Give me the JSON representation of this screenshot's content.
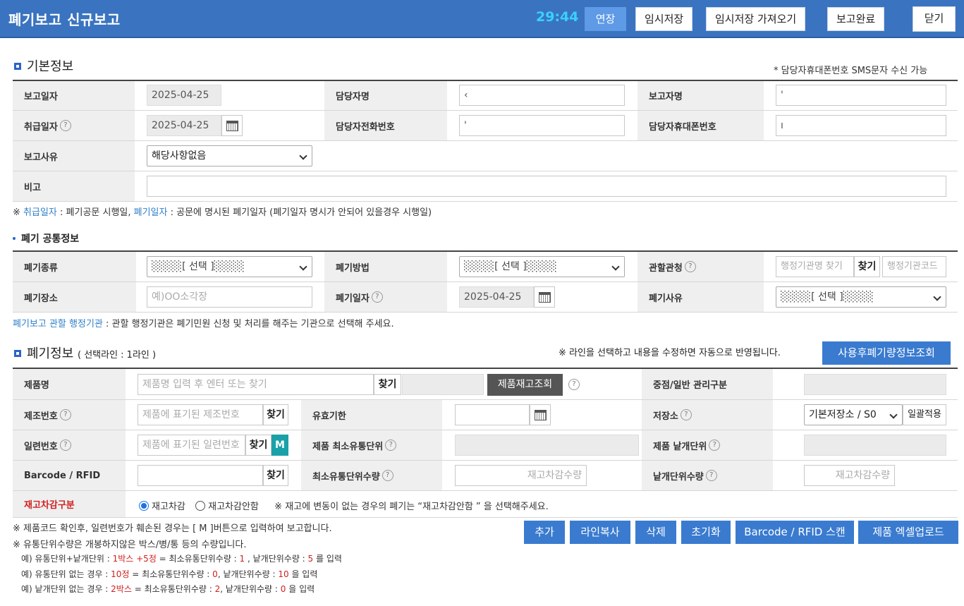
{
  "header": {
    "title": "폐기보고 신규보고",
    "timer": "29:44",
    "extend": "연장",
    "temp_save": "임시저장",
    "temp_load": "임시저장 가져오기",
    "complete": "보고완료",
    "close": "닫기"
  },
  "basic": {
    "title": "기본정보",
    "sms_note": "* 담당자휴대폰번호 SMS문자 수신 가능",
    "report_date_label": "보고일자",
    "report_date": "2025-04-25",
    "manager_label": "담당자명",
    "manager_value": "‹",
    "reporter_label": "보고자명",
    "reporter_value": "'",
    "handle_date_label": "취급일자",
    "handle_date": "2025-04-25",
    "manager_phone_label": "담당자전화번호",
    "manager_phone_value": "'",
    "manager_mobile_label": "담당자휴대폰번호",
    "manager_mobile_value": "ı",
    "reason_label": "보고사유",
    "reason_value": "해당사항없음",
    "memo_label": "비고",
    "help": "?"
  },
  "note1": {
    "mark": "※ ",
    "link1": "취급일자",
    "text1": " : 폐기공문 시행일, ",
    "link2": "폐기일자",
    "text2": " : 공문에 명시된 폐기일자 (폐기일자 명시가 안되어 있을경우 시행일)"
  },
  "common": {
    "title": "폐기 공통정보",
    "type_label": "폐기종류",
    "type_value": "░░░░[ 선택 ]░░░░",
    "method_label": "폐기방법",
    "method_value": "░░░░[ 선택 ]░░░░",
    "agency_label": "관할관청",
    "agency_placeholder": "행정기관명 찾기",
    "agency_find": "찾기",
    "agency_code_placeholder": "행정기관코드",
    "place_label": "폐기장소",
    "place_placeholder": "예)OO소각장",
    "date_label": "폐기일자",
    "date_value": "2025-04-25",
    "reason_label": "폐기사유",
    "reason_value": "░░░░[ 선택 ]░░░░"
  },
  "note2": {
    "link": "폐기보고 관할 행정기관",
    "text": " : 관할 행정기관은 폐기민원 신청 및 처리를 해주는 기관으로 선택해 주세요."
  },
  "disposal": {
    "title": "폐기정보",
    "subtitle": "( 선택라인 : 1라인 )",
    "line_note": "※ 라인을 선택하고 내용을 수정하면 자동으로 반영됩니다.",
    "lookup_button": "사용후폐기량정보조회",
    "product_label": "제품명",
    "product_placeholder": "제품명 입력 후 엔터 또는 찾기",
    "find": "찾기",
    "stock_button": "제품재고조회",
    "manage_label": "중점/일반 관리구분",
    "lot_label": "제조번호",
    "lot_placeholder": "제품에 표기된 제조번호",
    "expiry_label": "유효기한",
    "storage_label": "저장소",
    "storage_value": "기본저장소 / S0",
    "bulk_apply": "일괄적용",
    "serial_label": "일련번호",
    "serial_placeholder": "제품에 표기된 일련번호",
    "m_button": "M",
    "min_unit_label": "제품 최소유통단위",
    "each_unit_label": "제품 낱개단위",
    "barcode_label": "Barcode / RFID",
    "min_qty_label": "최소유통단위수량",
    "min_qty_placeholder": "재고차감수량",
    "each_qty_label": "낱개단위수량",
    "each_qty_placeholder": "재고차감수량",
    "deduct_label": "재고차감구분",
    "deduct_on": "재고차감",
    "deduct_off": "재고차감안함",
    "deduct_note": "※ 재고에 변동이 없는 경우의 폐기는 “재고차감안함 ” 을 선택해주세요."
  },
  "footer_notes": {
    "n1": "※ 제품코드 확인후, 일련번호가 훼손된 경우는 [ M ]버튼으로 입력하여 보고합니다.",
    "n2": "※ 유통단위수량은 개봉하지않은 박스/병/통 등의 수량입니다.",
    "e1a": "예) 유통단위+낱개단위 : ",
    "e1b": "1박스 +5정",
    "e1c": " = 최소유통단위수량 : ",
    "e1d": "1",
    "e1e": " , 낱개단위수량 : ",
    "e1f": "5",
    "e1g": " 를 입력",
    "e2a": "예) 유통단위 없는 경우 : ",
    "e2b": "10정",
    "e2c": " = 최소유통단위수량 : ",
    "e2d": "0",
    "e2e": ", 낱개단위수량 : ",
    "e2f": "10",
    "e2g": " 을 입력",
    "e3a": "예) 낱개단위 없는 경우 : ",
    "e3b": "2박스",
    "e3c": " = 최소유통단위수량 : ",
    "e3d": "2",
    "e3e": ", 낱개단위수량 : ",
    "e3f": "0",
    "e3g": " 을 입력"
  },
  "actions": {
    "add": "추가",
    "copy": "라인복사",
    "delete": "삭제",
    "reset": "초기화",
    "scan": "Barcode / RFID 스캔",
    "excel": "제품 엑셀업로드"
  },
  "colors": {
    "header": "#3a74c0",
    "accent": "#3a7bd0",
    "timer": "#3ad0ff",
    "required": "#d02020"
  }
}
